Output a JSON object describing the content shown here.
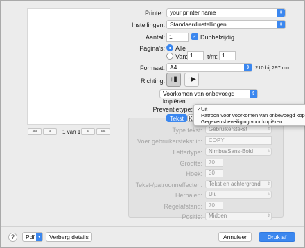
{
  "preview": {
    "page_info": "1 van 1",
    "first_btn": "◂◂",
    "prev_btn": "◂",
    "next_btn": "▸",
    "last_btn": "▸▸"
  },
  "printer": {
    "label": "Printer:",
    "value": "your printer name"
  },
  "presets": {
    "label": "Instellingen:",
    "value": "Standaardinstellingen"
  },
  "copies": {
    "label": "Aantal:",
    "value": "1",
    "duplex_label": "Dubbelzijdig",
    "duplex_checked": true
  },
  "pages": {
    "label": "Pagina's:",
    "all_label": "Alle",
    "from_label": "Van:",
    "from_value": "1",
    "to_label": "t/m:",
    "to_value": "1",
    "selected": "Alle"
  },
  "paper": {
    "label": "Formaat:",
    "value": "A4",
    "dims": "210 bij 297 mm"
  },
  "orientation": {
    "label": "Richting:",
    "portrait_icon": "portrait-icon",
    "landscape_icon": "landscape-icon"
  },
  "section": {
    "value": "Voorkomen van onbevoegd kopiëren"
  },
  "prevention": {
    "label": "Preventietype:",
    "menu": [
      {
        "label": "Uit",
        "checked": true
      },
      {
        "label": "Patroon voor voorkomen van onbevoegd kopiëren",
        "checked": false
      },
      {
        "label": "Gegevensbeveiliging voor kopiëren",
        "checked": false
      }
    ]
  },
  "tabs": [
    {
      "label": "Tekst",
      "active": true
    },
    {
      "label": "K",
      "active": false
    }
  ],
  "panel": {
    "text_type": {
      "label": "Type tekst:",
      "value": "Gebruikerstekst"
    },
    "user_text": {
      "label": "Voer gebruikerstekst in:",
      "value": "COPY"
    },
    "font": {
      "label": "Lettertype:",
      "value": "NimbusSans-Bold"
    },
    "size": {
      "label": "Grootte:",
      "value": "70"
    },
    "angle": {
      "label": "Hoek:",
      "value": "30"
    },
    "effect": {
      "label": "Tekst-/patroonneffecten:",
      "value": "Tekst en achtergrond"
    },
    "repeat": {
      "label": "Herhalen:",
      "value": "Uit"
    },
    "line_spacing": {
      "label": "Regelafstand:",
      "value": "70"
    },
    "position": {
      "label": "Positie:",
      "value": "Midden"
    }
  },
  "footer": {
    "help": "?",
    "pdf": "Pdf",
    "hide_details": "Verberg details",
    "cancel": "Annuleer",
    "print": "Druk af"
  },
  "colors": {
    "accent": "#3b87ef",
    "dialog_bg": "#ececec"
  }
}
